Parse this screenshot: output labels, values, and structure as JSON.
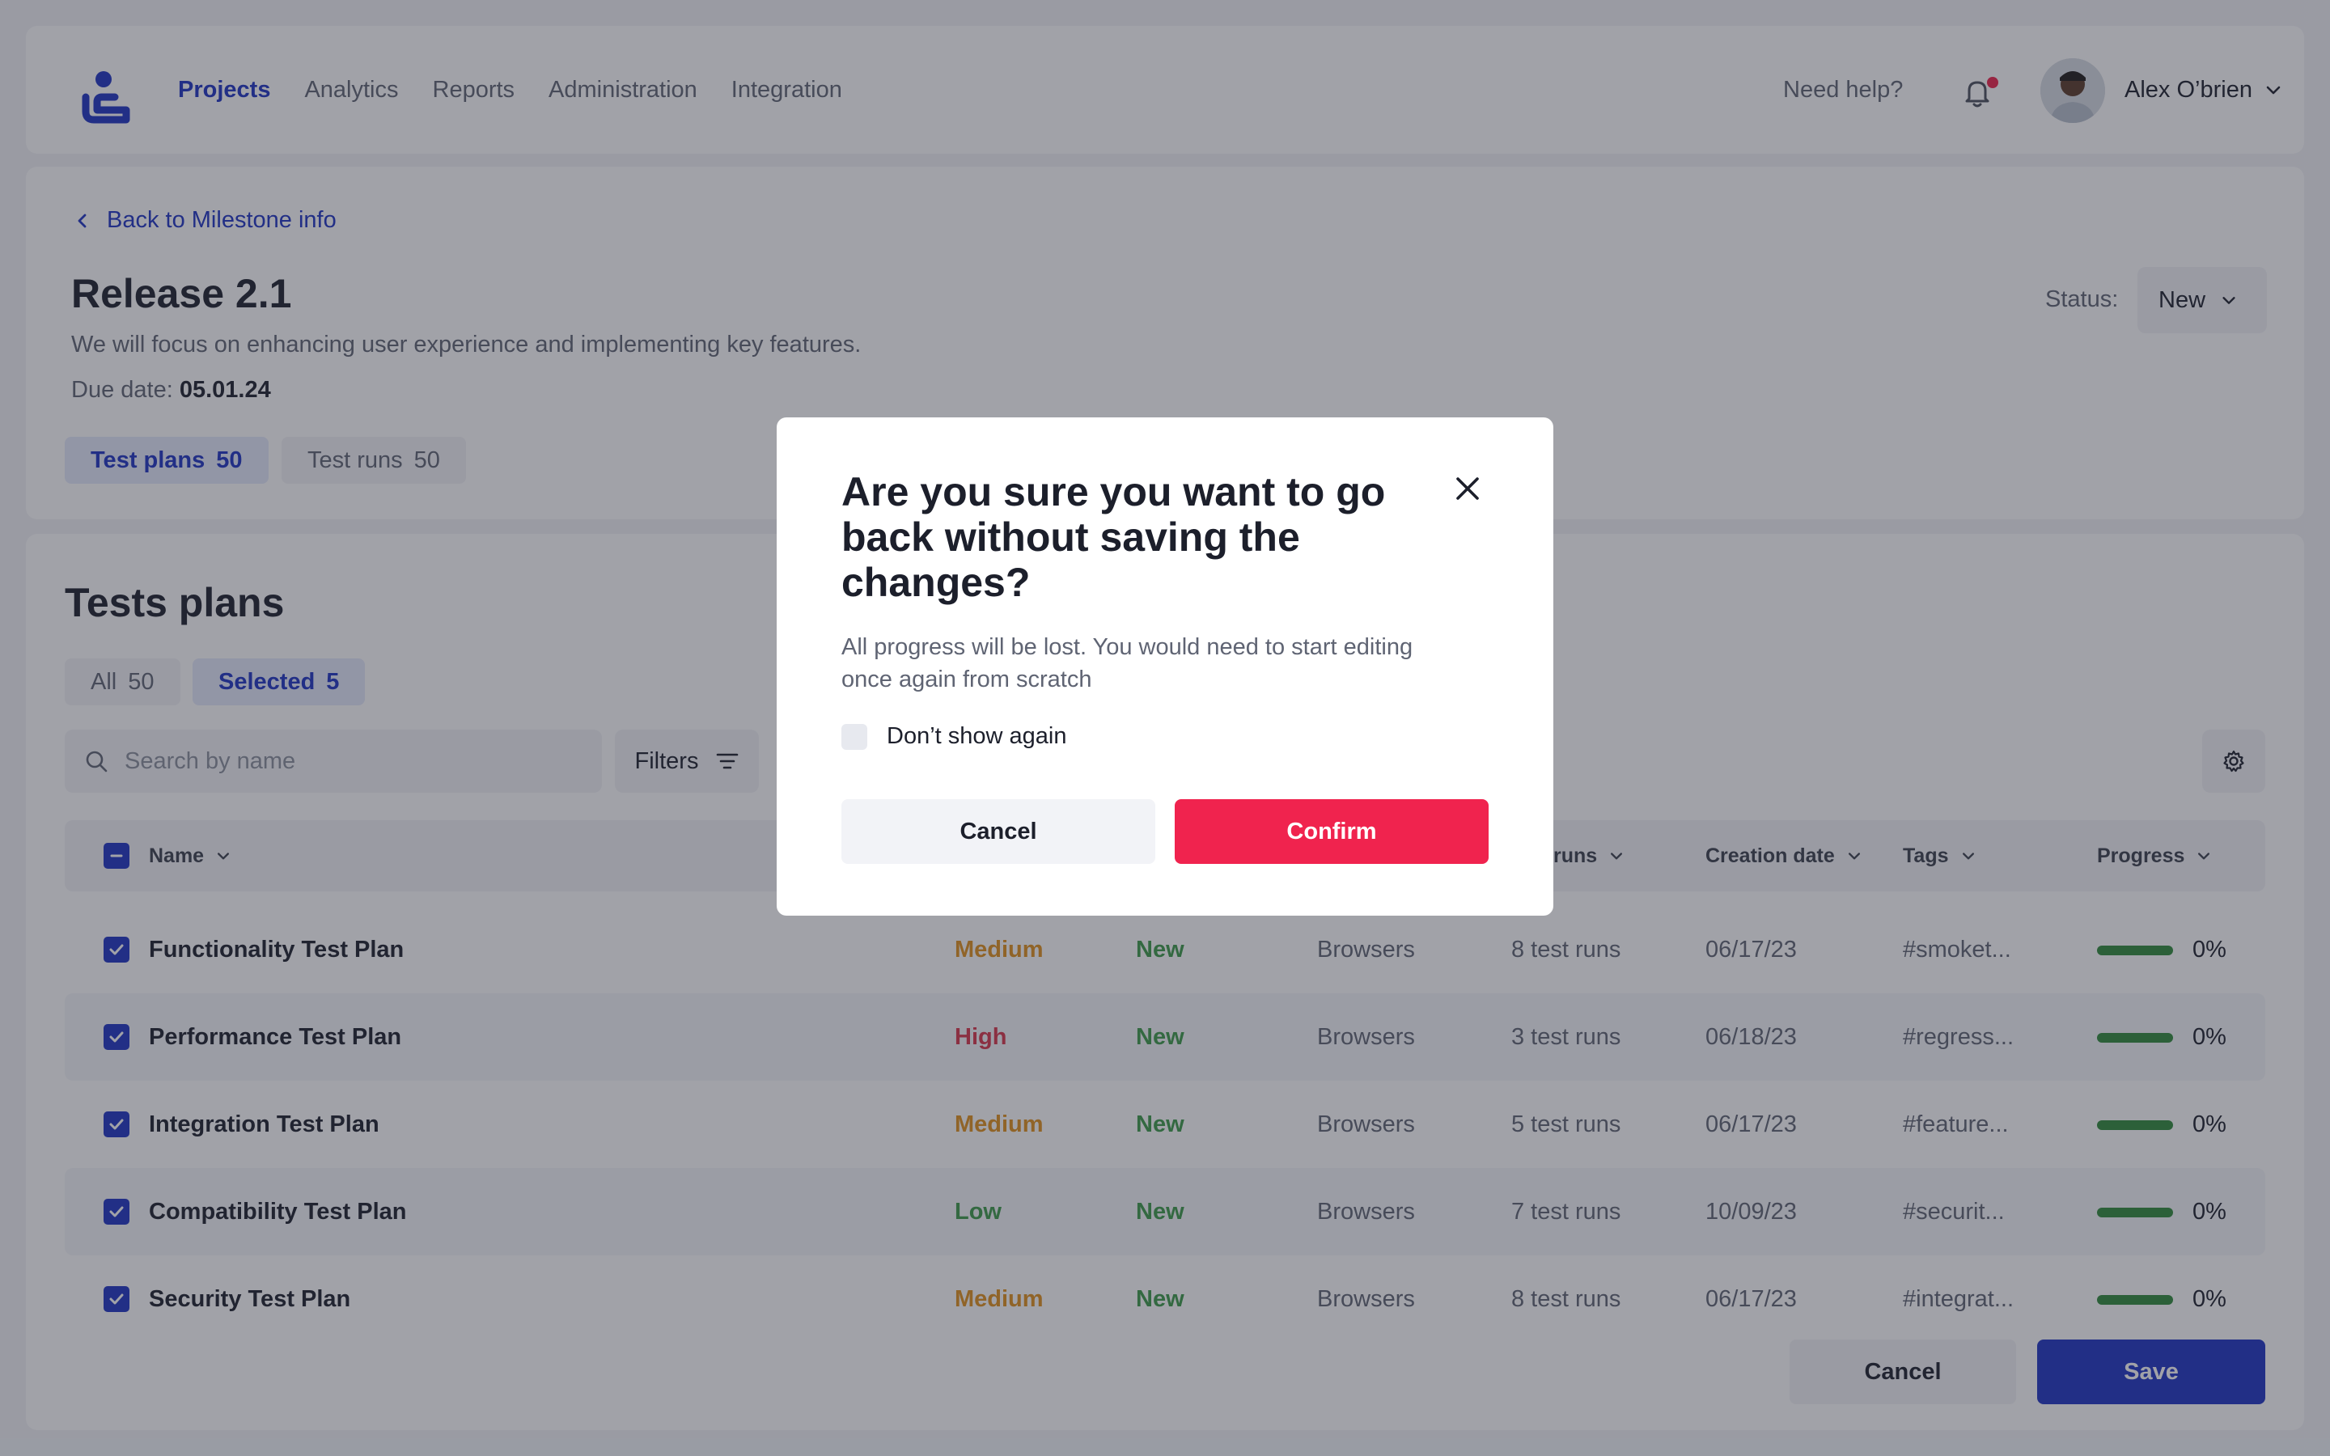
{
  "header": {
    "nav": [
      "Projects",
      "Analytics",
      "Reports",
      "Administration",
      "Integration"
    ],
    "help": "Need help?",
    "user_name": "Alex O’brien"
  },
  "milestone": {
    "back_label": "Back to Milestone info",
    "title": "Release 2.1",
    "description": "We will focus on enhancing user experience and implementing key features.",
    "due_label": "Due date:",
    "due_value": "05.01.24",
    "status_label": "Status:",
    "status_value": "New",
    "tabs": [
      {
        "label": "Test plans",
        "count": "50"
      },
      {
        "label": "Test runs",
        "count": "50"
      }
    ]
  },
  "plans": {
    "title": "Tests plans",
    "filter_tabs": [
      {
        "label": "All",
        "count": "50"
      },
      {
        "label": "Selected",
        "count": "5"
      }
    ],
    "search_placeholder": "Search by name",
    "filters_label": "Filters",
    "columns": {
      "name": "Name",
      "runs": "runs",
      "creation": "Creation date",
      "tags": "Tags",
      "progress": "Progress"
    },
    "rows": [
      {
        "name": "Functionality Test Plan",
        "priority": "Medium",
        "status": "New",
        "env": "Browsers",
        "runs": "8 test runs",
        "date": "06/17/23",
        "tags": "#smoket...",
        "progress": "0%"
      },
      {
        "name": "Performance Test Plan",
        "priority": "High",
        "status": "New",
        "env": "Browsers",
        "runs": "3 test runs",
        "date": "06/18/23",
        "tags": "#regress...",
        "progress": "0%"
      },
      {
        "name": "Integration Test Plan",
        "priority": "Medium",
        "status": "New",
        "env": "Browsers",
        "runs": "5 test runs",
        "date": "06/17/23",
        "tags": "#feature...",
        "progress": "0%"
      },
      {
        "name": "Compatibility Test Plan",
        "priority": "Low",
        "status": "New",
        "env": "Browsers",
        "runs": "7 test runs",
        "date": "10/09/23",
        "tags": "#securit...",
        "progress": "0%"
      },
      {
        "name": "Security Test Plan",
        "priority": "Medium",
        "status": "New",
        "env": "Browsers",
        "runs": "8 test runs",
        "date": "06/17/23",
        "tags": "#integrat...",
        "progress": "0%"
      }
    ],
    "cancel_label": "Cancel",
    "save_label": "Save"
  },
  "modal": {
    "title": "Are you sure you want to go back without saving the changes?",
    "body": "All progress will be lost. You would need to start editing once again from scratch",
    "checkbox_label": "Don’t show again",
    "cancel_label": "Cancel",
    "confirm_label": "Confirm"
  },
  "colors": {
    "accent": "#1d33c2",
    "danger": "#f0234e",
    "medium": "#e0901b",
    "high": "#d8344a",
    "low": "#3c9a48",
    "status_new": "#3c9a48",
    "progress_bar": "#2f8a3a"
  }
}
